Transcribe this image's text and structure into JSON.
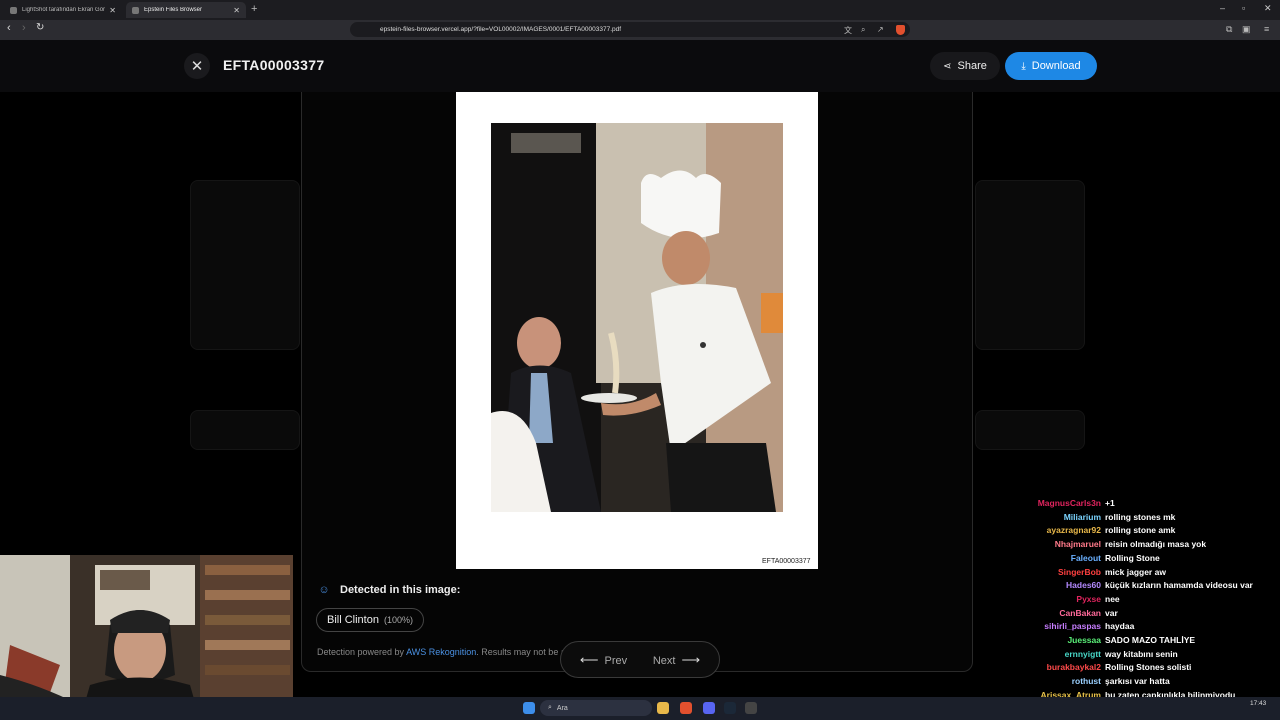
{
  "browser": {
    "tabs": [
      {
        "label": "LightShot tarafından Ekran Görüntüsü",
        "active": false
      },
      {
        "label": "Epstein Files Browser",
        "active": true
      }
    ],
    "url": "epstein-files-browser.vercel.app/?file=VOL00002/IMAGES/0001/EFTA00003377.pdf"
  },
  "viewer": {
    "title": "EFTA00003377",
    "share_label": "Share",
    "download_label": "Download",
    "page_label": "EFTA00003377"
  },
  "detection": {
    "heading": "Detected in this image:",
    "people": [
      {
        "name": "Bill Clinton",
        "confidence": "(100%)"
      }
    ],
    "footnote_prefix": "Detection powered by",
    "footnote_link": "AWS Rekognition",
    "footnote_suffix": ". Results may not be a"
  },
  "pager": {
    "prev_label": "Prev",
    "next_label": "Next"
  },
  "chat": [
    {
      "name": "MagnusCarls3n",
      "color": "#e0245e",
      "msg": "+1"
    },
    {
      "name": "Miliarium",
      "color": "#7bd4ff",
      "msg": "rolling stones mk"
    },
    {
      "name": "ayazragnar92",
      "color": "#e8b84a",
      "msg": "rolling stone amk"
    },
    {
      "name": "Nhajmaruel",
      "color": "#ff7a8a",
      "msg": "reisin olmadığı masa yok"
    },
    {
      "name": "Faleout",
      "color": "#6ab0ff",
      "msg": "Rolling Stone"
    },
    {
      "name": "SingerBob",
      "color": "#ff4040",
      "msg": "mick jagger aw"
    },
    {
      "name": "Hades60",
      "color": "#b48aff",
      "msg": "küçük kızların hamamda videosu var"
    },
    {
      "name": "Pyxse",
      "color": "#e0245e",
      "msg": "nee"
    },
    {
      "name": "CanBakan",
      "color": "#ff6a9a",
      "msg": "var"
    },
    {
      "name": "sihirli_paspas",
      "color": "#c77dff",
      "msg": "haydaa"
    },
    {
      "name": "Juessaa",
      "color": "#5af078",
      "msg": "SADO MAZO TAHLİYE"
    },
    {
      "name": "ernnyigtt",
      "color": "#48d8c8",
      "msg": "way kitabını senin"
    },
    {
      "name": "burakbaykal2",
      "color": "#ff4a4a",
      "msg": "Rolling Stones solisti"
    },
    {
      "name": "rothust",
      "color": "#9ad0ff",
      "msg": "şarkısı var hatta"
    },
    {
      "name": "Arissax_Atrum",
      "color": "#e8c24a",
      "msg": "bu zaten çapkınlıkla bilinmiyodu"
    }
  ],
  "taskbar": {
    "search_placeholder": "Ara",
    "time": "17:43"
  },
  "colors": {
    "accent": "#1e88e5",
    "link": "#4a90e2"
  }
}
